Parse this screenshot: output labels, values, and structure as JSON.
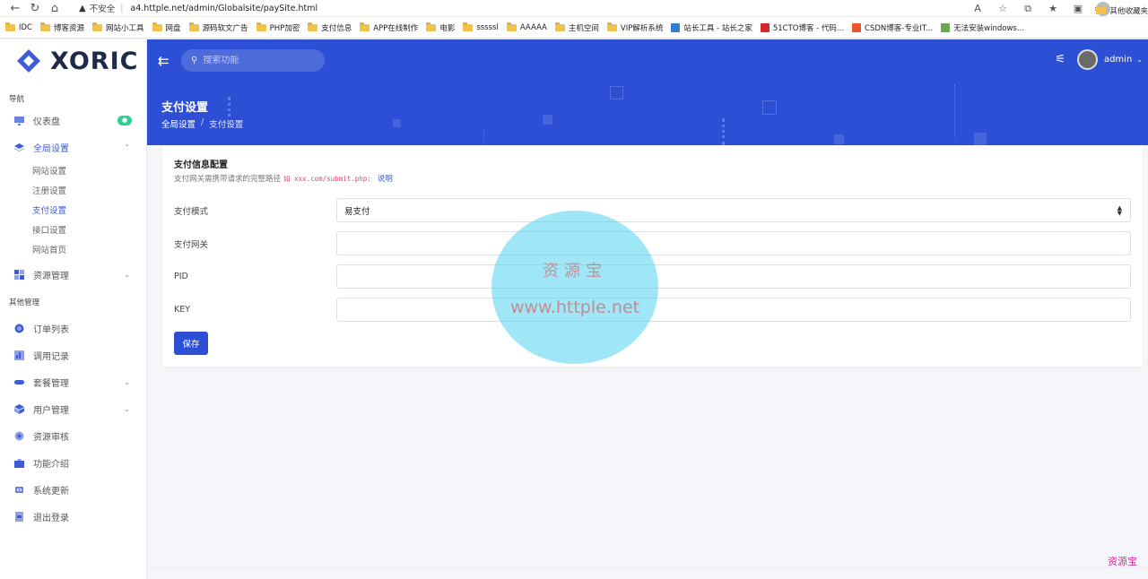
{
  "browser": {
    "insecure_label": "不安全",
    "url": "a4.httple.net/admin/Globalsite/paySite.html",
    "bookmarks": [
      "IDC",
      "博客资源",
      "网站小工具",
      "网盘",
      "源码软文广告",
      "PHP加密",
      "支付信息",
      "APP在线制作",
      "电影",
      "sssssl",
      "AAAAA",
      "主机空间",
      "VIP解析系统",
      "站长工具 - 站长之家",
      "51CTO博客 - 代码...",
      "CSDN博客-专业IT...",
      "无法安装windows..."
    ],
    "other_bookmarks": "其他收藏夹"
  },
  "sidebar": {
    "logo_text": "XORIC",
    "nav_title": "导航",
    "dashboard": "仪表盘",
    "dashboard_badge": "●",
    "global_settings": "全局设置",
    "sub_items": [
      "网站设置",
      "注册设置",
      "支付设置",
      "接口设置",
      "网站首页"
    ],
    "resource_mgmt": "资源管理",
    "other_title": "其他管理",
    "other_items": [
      "订单列表",
      "调用记录",
      "套餐管理",
      "用户管理",
      "资源审核",
      "功能介绍",
      "系统更新",
      "退出登录"
    ]
  },
  "header": {
    "search_placeholder": "搜索功能",
    "username": "admin",
    "page_title": "支付设置",
    "breadcrumb_parent": "全局设置",
    "breadcrumb_current": "支付设置"
  },
  "card": {
    "title": "支付信息配置",
    "subtitle_prefix": "支付网关需携带请求的完整路径",
    "subtitle_code": "如 xxx.com/submit.php:",
    "subtitle_link": "说明",
    "mode_label": "支付模式",
    "mode_value": "易支付",
    "gateway_label": "支付网关",
    "gateway_value": "",
    "pid_label": "PID",
    "pid_value": "",
    "key_label": "KEY",
    "key_value": "",
    "save_label": "保存"
  },
  "watermark": {
    "line1": "资源宝",
    "line2": "www.httple.net",
    "corner": "资源宝"
  },
  "colors": {
    "primary": "#2d4fd6",
    "accent_text": "#3f5bd5",
    "badge": "#2fcf8f"
  }
}
